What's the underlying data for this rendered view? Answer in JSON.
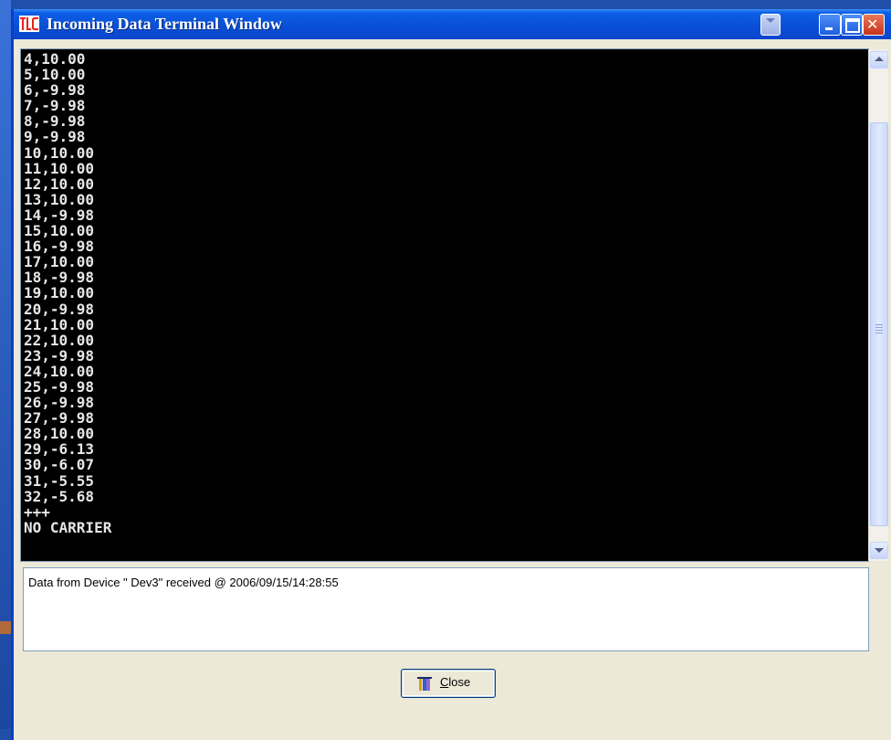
{
  "window": {
    "title": "Incoming Data Terminal Window",
    "app_icon": "tlc-logo-icon",
    "controls": {
      "dropdown_icon": "chevron-down-icon",
      "minimize_icon": "minimize-icon",
      "maximize_icon": "maximize-icon",
      "close_icon": "close-icon",
      "close_glyph": "✕"
    }
  },
  "terminal": {
    "lines": [
      "4,10.00",
      "5,10.00",
      "6,-9.98",
      "7,-9.98",
      "8,-9.98",
      "9,-9.98",
      "10,10.00",
      "11,10.00",
      "12,10.00",
      "13,10.00",
      "14,-9.98",
      "15,10.00",
      "16,-9.98",
      "17,10.00",
      "18,-9.98",
      "19,10.00",
      "20,-9.98",
      "21,10.00",
      "22,10.00",
      "23,-9.98",
      "24,10.00",
      "25,-9.98",
      "26,-9.98",
      "27,-9.98",
      "28,10.00",
      "29,-6.13",
      "30,-6.07",
      "31,-5.55",
      "32,-5.68",
      "+++",
      "NO CARRIER"
    ]
  },
  "status": {
    "message": "Data from Device \" Dev3\" received @ 2006/09/15/14:28:55"
  },
  "buttons": {
    "close_label": "Close",
    "close_mnemonic": "C",
    "close_rest": "lose",
    "close_icon": "exit-door-icon"
  },
  "colors": {
    "titlebar": "#0a4ed6",
    "terminal_bg": "#000000",
    "terminal_fg": "#e6e6e6",
    "window_bg": "#ece9d8",
    "logo_red": "#e8231b"
  }
}
